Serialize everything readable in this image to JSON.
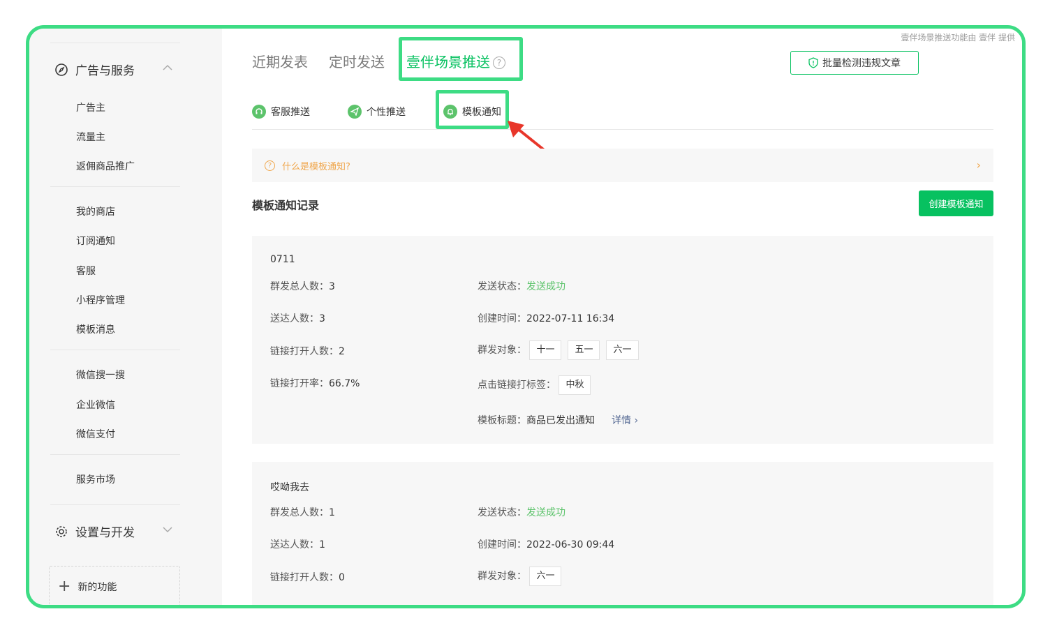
{
  "credit_text": "壹伴场景推送功能由 壹伴 提供",
  "sidebar": {
    "section1": {
      "label": "广告与服务"
    },
    "items": [
      "广告主",
      "流量主",
      "返佣商品推广",
      "我的商店",
      "订阅通知",
      "客服",
      "小程序管理",
      "模板消息",
      "微信搜一搜",
      "企业微信",
      "微信支付",
      "服务市场"
    ],
    "section2": {
      "label": "设置与开发"
    },
    "new_feature": "新的功能"
  },
  "top_tabs": [
    {
      "label": "近期发表"
    },
    {
      "label": "定时发送"
    },
    {
      "label": "壹伴场景推送",
      "active": true
    }
  ],
  "batch_button": "批量检测违规文章",
  "sub_tabs": [
    {
      "label": "客服推送",
      "icon": "headset-icon"
    },
    {
      "label": "个性推送",
      "icon": "send-icon"
    },
    {
      "label": "模板通知",
      "icon": "bell-icon",
      "active": true
    }
  ],
  "notice": {
    "text": "什么是模板通知?"
  },
  "section_title": "模板通知记录",
  "create_button": "创建模板通知",
  "records": [
    {
      "title": "0711",
      "total_label": "群发总人数：",
      "total": "3",
      "delivered_label": "送达人数：",
      "delivered": "3",
      "opened_label": "链接打开人数：",
      "opened": "2",
      "rate_label": "链接打开率：",
      "rate": "66.7%",
      "status_label": "发送状态：",
      "status": "发送成功",
      "created_label": "创建时间：",
      "created": "2022-07-11 16:34",
      "target_label": "群发对象：",
      "targets": [
        "十一",
        "五一",
        "六一"
      ],
      "click_tag_label": "点击链接打标签：",
      "click_tags": [
        "中秋"
      ],
      "template_label": "模板标题：",
      "template_title": "商品已发出通知",
      "detail_link": "详情"
    },
    {
      "title": "哎呦我去",
      "total_label": "群发总人数：",
      "total": "1",
      "delivered_label": "送达人数：",
      "delivered": "1",
      "opened_label": "链接打开人数：",
      "opened": "0",
      "status_label": "发送状态：",
      "status": "发送成功",
      "created_label": "创建时间：",
      "created": "2022-06-30 09:44",
      "target_label": "群发对象：",
      "targets": [
        "六一"
      ]
    }
  ],
  "colors": {
    "accent": "#07c160",
    "highlight": "#3ddc84",
    "warning": "#f0a64b",
    "success": "#5cc36b",
    "link": "#576b95",
    "annotation_arrow": "#e8362a"
  }
}
